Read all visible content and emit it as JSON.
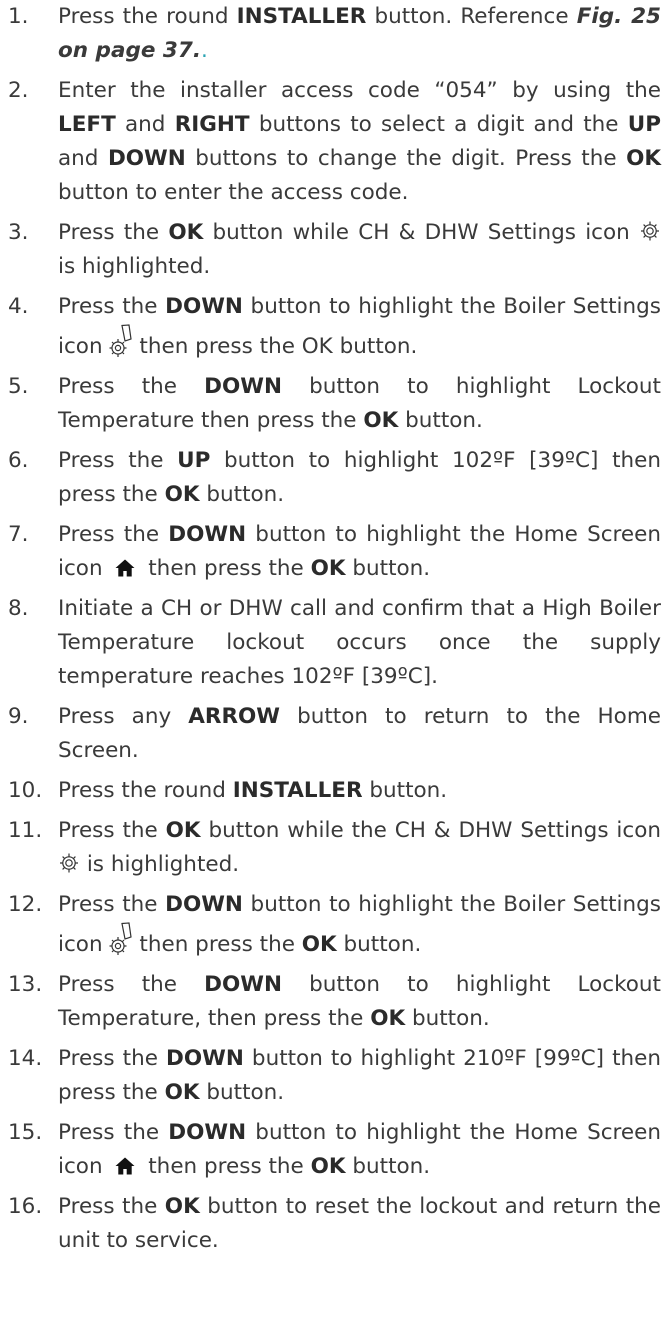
{
  "steps": [
    {
      "number": "1.",
      "parts": [
        {
          "t": "Press the round "
        },
        {
          "t": "INSTALLER",
          "s": "b"
        },
        {
          "t": " button. Reference  "
        },
        {
          "t": "Fig. 25 on page 37.",
          "s": "ref"
        },
        {
          "t": ".",
          "s": "dot"
        }
      ]
    },
    {
      "number": "2.",
      "parts": [
        {
          "t": "Enter the installer access code “054” by using the "
        },
        {
          "t": "LEFT",
          "s": "b"
        },
        {
          "t": " and "
        },
        {
          "t": "RIGHT",
          "s": "b"
        },
        {
          "t": " buttons to select a digit and the "
        },
        {
          "t": "UP",
          "s": "b"
        },
        {
          "t": " and "
        },
        {
          "t": "DOWN",
          "s": "b"
        },
        {
          "t": " buttons to change the digit. Press the "
        },
        {
          "t": "OK",
          "s": "b"
        },
        {
          "t": " button to enter the access code."
        }
      ]
    },
    {
      "number": "3.",
      "parts": [
        {
          "t": "Press the "
        },
        {
          "t": "OK",
          "s": "b"
        },
        {
          "t": " button while CH & DHW Settings icon "
        },
        {
          "icon": "gear-settings-icon"
        },
        {
          "t": "  is highlighted."
        }
      ]
    },
    {
      "number": "4.",
      "parts": [
        {
          "t": "Press the "
        },
        {
          "t": "DOWN",
          "s": "b"
        },
        {
          "t": " button to highlight the Boiler Settings icon "
        },
        {
          "icon": "boiler-settings-icon"
        },
        {
          "t": "then press the OK button."
        }
      ]
    },
    {
      "number": "5.",
      "parts": [
        {
          "t": "Press the "
        },
        {
          "t": "DOWN",
          "s": "b"
        },
        {
          "t": " button to highlight Lockout Temperature then press the "
        },
        {
          "t": "OK",
          "s": "b"
        },
        {
          "t": " button."
        }
      ]
    },
    {
      "number": "6.",
      "parts": [
        {
          "t": "Press the "
        },
        {
          "t": "UP",
          "s": "b"
        },
        {
          "t": " button to highlight 102ºF [39ºC] then press the "
        },
        {
          "t": "OK",
          "s": "b"
        },
        {
          "t": " button."
        }
      ]
    },
    {
      "number": "7.",
      "parts": [
        {
          "t": "Press the "
        },
        {
          "t": "DOWN",
          "s": "b"
        },
        {
          "t": " button to highlight the Home Screen icon "
        },
        {
          "icon": "home-icon"
        },
        {
          "t": " then press the "
        },
        {
          "t": "OK",
          "s": "b"
        },
        {
          "t": " button."
        }
      ]
    },
    {
      "number": "8.",
      "parts": [
        {
          "t": "Initiate a CH or DHW call and confirm that a High Boiler Temperature lockout occurs once the supply temperature reaches 102ºF [39ºC]."
        }
      ]
    },
    {
      "number": "9.",
      "parts": [
        {
          "t": "Press any "
        },
        {
          "t": "ARROW",
          "s": "b"
        },
        {
          "t": " button to return to the Home Screen."
        }
      ]
    },
    {
      "number": "10.",
      "parts": [
        {
          "t": "Press the round "
        },
        {
          "t": "INSTALLER",
          "s": "b"
        },
        {
          "t": "  button."
        }
      ]
    },
    {
      "number": "11.",
      "parts": [
        {
          "t": "Press the "
        },
        {
          "t": "OK",
          "s": "b"
        },
        {
          "t": " button while the CH & DHW Settings icon "
        },
        {
          "icon": "gear-settings-icon"
        },
        {
          "t": "  is highlighted."
        }
      ]
    },
    {
      "number": "12.",
      "parts": [
        {
          "t": "Press the "
        },
        {
          "t": "DOWN",
          "s": "b"
        },
        {
          "t": " button to highlight the Boiler Settings icon "
        },
        {
          "icon": "boiler-settings-icon"
        },
        {
          "t": "then press the "
        },
        {
          "t": "OK",
          "s": "b"
        },
        {
          "t": " button."
        }
      ]
    },
    {
      "number": "13.",
      "parts": [
        {
          "t": "Press the "
        },
        {
          "t": "DOWN",
          "s": "b"
        },
        {
          "t": " button to highlight Lockout Temperature, then press the "
        },
        {
          "t": "OK",
          "s": "b"
        },
        {
          "t": " button."
        }
      ]
    },
    {
      "number": "14.",
      "parts": [
        {
          "t": "Press the "
        },
        {
          "t": "DOWN",
          "s": "b"
        },
        {
          "t": " button to highlight 210ºF [99ºC] then press the "
        },
        {
          "t": "OK",
          "s": "b"
        },
        {
          "t": " button."
        }
      ]
    },
    {
      "number": "15.",
      "parts": [
        {
          "t": "Press the "
        },
        {
          "t": "DOWN",
          "s": "b"
        },
        {
          "t": " button to highlight the Home Screen icon "
        },
        {
          "icon": "home-icon"
        },
        {
          "t": " then press the "
        },
        {
          "t": "OK",
          "s": "b"
        },
        {
          "t": " button."
        }
      ]
    },
    {
      "number": "16.",
      "parts": [
        {
          "t": "Press the "
        },
        {
          "t": "OK",
          "s": "b"
        },
        {
          "t": " button to reset the lockout and return the unit to service."
        }
      ]
    }
  ]
}
